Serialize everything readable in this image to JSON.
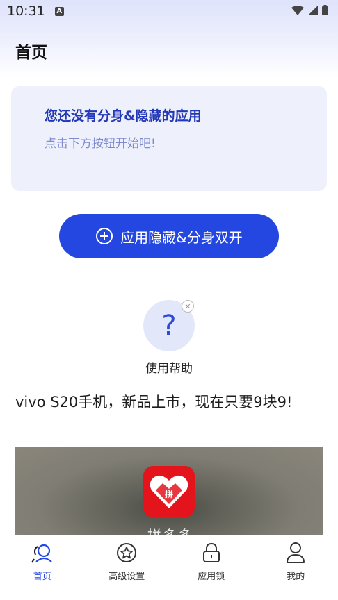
{
  "status_bar": {
    "time": "10:31",
    "indicator": "A"
  },
  "header": {
    "title": "首页"
  },
  "empty_state": {
    "title": "您还没有分身&隐藏的应用",
    "subtitle": "点击下方按钮开始吧!"
  },
  "primary_action": {
    "label": "应用隐藏&分身双开",
    "icon": "plus-circle-icon"
  },
  "help": {
    "symbol": "?",
    "label": "使用帮助"
  },
  "ad": {
    "title": "vivo S20手机，新品上市，现在只要9块9!",
    "image_caption": "拼多多",
    "logo_glyph": "拼"
  },
  "bottom_nav": {
    "items": [
      {
        "label": "首页",
        "icon": "home-search-icon",
        "active": true
      },
      {
        "label": "高级设置",
        "icon": "star-circle-icon",
        "active": false
      },
      {
        "label": "应用锁",
        "icon": "lock-icon",
        "active": false
      },
      {
        "label": "我的",
        "icon": "person-icon",
        "active": false
      }
    ]
  },
  "colors": {
    "accent": "#2347e0",
    "card_bg": "#eef0fb",
    "empty_title": "#2338b8",
    "empty_subtitle": "#7f8bcf",
    "ad_logo": "#e4141c"
  }
}
